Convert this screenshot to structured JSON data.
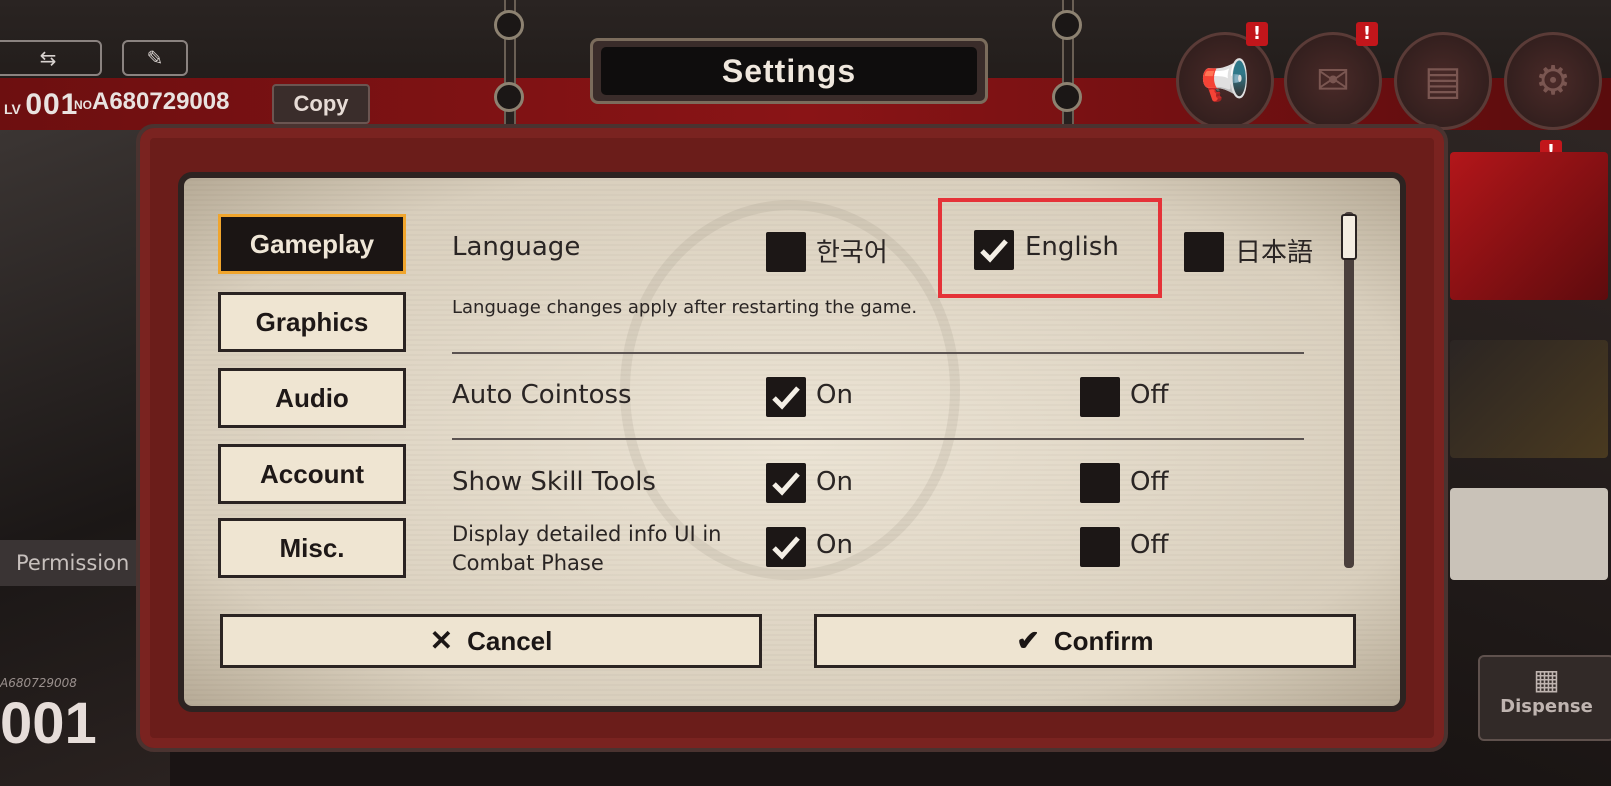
{
  "window_title": "Settings",
  "hud": {
    "level_prefix": "LV",
    "level": "001",
    "no_prefix": "NO",
    "user_id": "A680729008",
    "copy_label": "Copy",
    "permission_label": "Permission",
    "bottom_user_id": "A680729008",
    "bottom_level": "001",
    "dispenser_label": "Dispense",
    "badge_text": "!"
  },
  "tabs": [
    {
      "label": "Gameplay",
      "active": true
    },
    {
      "label": "Graphics",
      "active": false
    },
    {
      "label": "Audio",
      "active": false
    },
    {
      "label": "Account",
      "active": false
    },
    {
      "label": "Misc.",
      "active": false
    }
  ],
  "settings": {
    "language": {
      "label": "Language",
      "note": "Language changes apply after restarting the game.",
      "options": [
        {
          "label": "한국어",
          "checked": false
        },
        {
          "label": "English",
          "checked": true
        },
        {
          "label": "日本語",
          "checked": false
        }
      ]
    },
    "auto_cointoss": {
      "label": "Auto Cointoss",
      "on_label": "On",
      "off_label": "Off",
      "value": "On"
    },
    "show_skill_tools": {
      "label": "Show Skill Tools",
      "on_label": "On",
      "off_label": "Off",
      "value": "On"
    },
    "detailed_info": {
      "label_line1": "Display detailed info UI in",
      "label_line2": "Combat Phase",
      "on_label": "On",
      "off_label": "Off",
      "value": "On"
    }
  },
  "buttons": {
    "cancel": "Cancel",
    "confirm": "Confirm"
  },
  "colors": {
    "highlight": "#e53238",
    "active_tab_border": "#f0a52d",
    "frame_red": "#6b1d1a"
  }
}
